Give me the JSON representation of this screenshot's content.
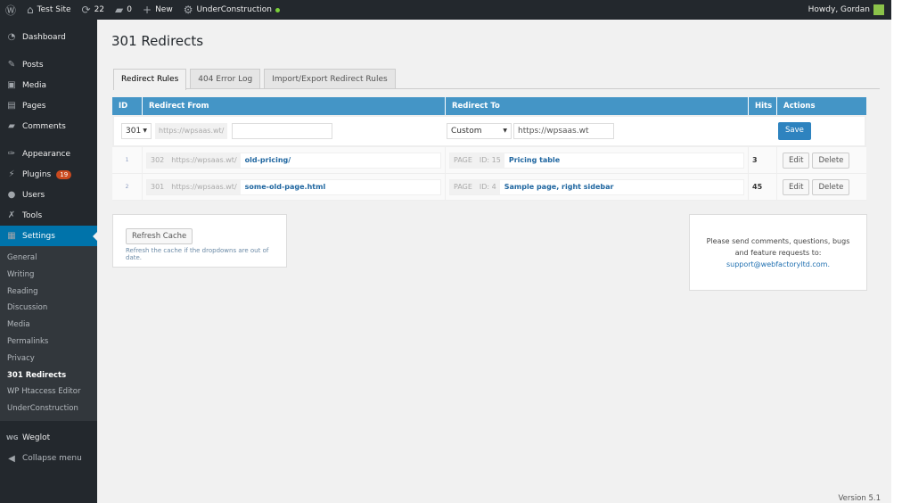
{
  "adminbar": {
    "site": "Test Site",
    "updates": "22",
    "comments": "0",
    "new": "New",
    "plugin": "UnderConstruction",
    "howdy": "Howdy, Gordan"
  },
  "sidebar": {
    "items": [
      {
        "label": "Dashboard",
        "icon": "dashboard-icon"
      },
      {
        "label": "Posts",
        "icon": "pin-icon"
      },
      {
        "label": "Media",
        "icon": "media-icon"
      },
      {
        "label": "Pages",
        "icon": "pages-icon"
      },
      {
        "label": "Comments",
        "icon": "comment-icon"
      },
      {
        "label": "Appearance",
        "icon": "brush-icon"
      },
      {
        "label": "Plugins",
        "icon": "plug-icon",
        "badge": "19"
      },
      {
        "label": "Users",
        "icon": "user-icon"
      },
      {
        "label": "Tools",
        "icon": "wrench-icon"
      },
      {
        "label": "Settings",
        "icon": "settings-icon"
      }
    ],
    "submenu": [
      "General",
      "Writing",
      "Reading",
      "Discussion",
      "Media",
      "Permalinks",
      "Privacy",
      "301 Redirects",
      "WP Htaccess Editor",
      "UnderConstruction"
    ],
    "weglot": "Weglot",
    "collapse": "Collapse menu"
  },
  "page": {
    "title": "301 Redirects",
    "tabs": [
      "Redirect Rules",
      "404 Error Log",
      "Import/Export Redirect Rules"
    ],
    "version": "Version 5.1"
  },
  "table": {
    "headers": [
      "ID",
      "Redirect From",
      "Redirect To",
      "Hits",
      "Actions"
    ],
    "new": {
      "code": "301",
      "prefix": "https://wpsaas.wt/",
      "from": "",
      "type": "Custom",
      "to": "https://wpsaas.wt",
      "save": "Save"
    },
    "rows": [
      {
        "id": "1",
        "code": "302",
        "prefix": "https://wpsaas.wt/",
        "from": "old-pricing/",
        "type": "PAGE",
        "pid": "ID: 15",
        "to": "Pricing table",
        "hits": "3"
      },
      {
        "id": "2",
        "code": "301",
        "prefix": "https://wpsaas.wt/",
        "from": "some-old-page.html",
        "type": "PAGE",
        "pid": "ID: 4",
        "to": "Sample page, right sidebar",
        "hits": "45"
      }
    ],
    "edit": "Edit",
    "delete": "Delete"
  },
  "cache": {
    "button": "Refresh Cache",
    "note": "Refresh the cache if the dropdowns are out of date."
  },
  "support": {
    "text": "Please send comments, questions, bugs and feature requests to:",
    "email": "support@webfactoryltd.com."
  }
}
